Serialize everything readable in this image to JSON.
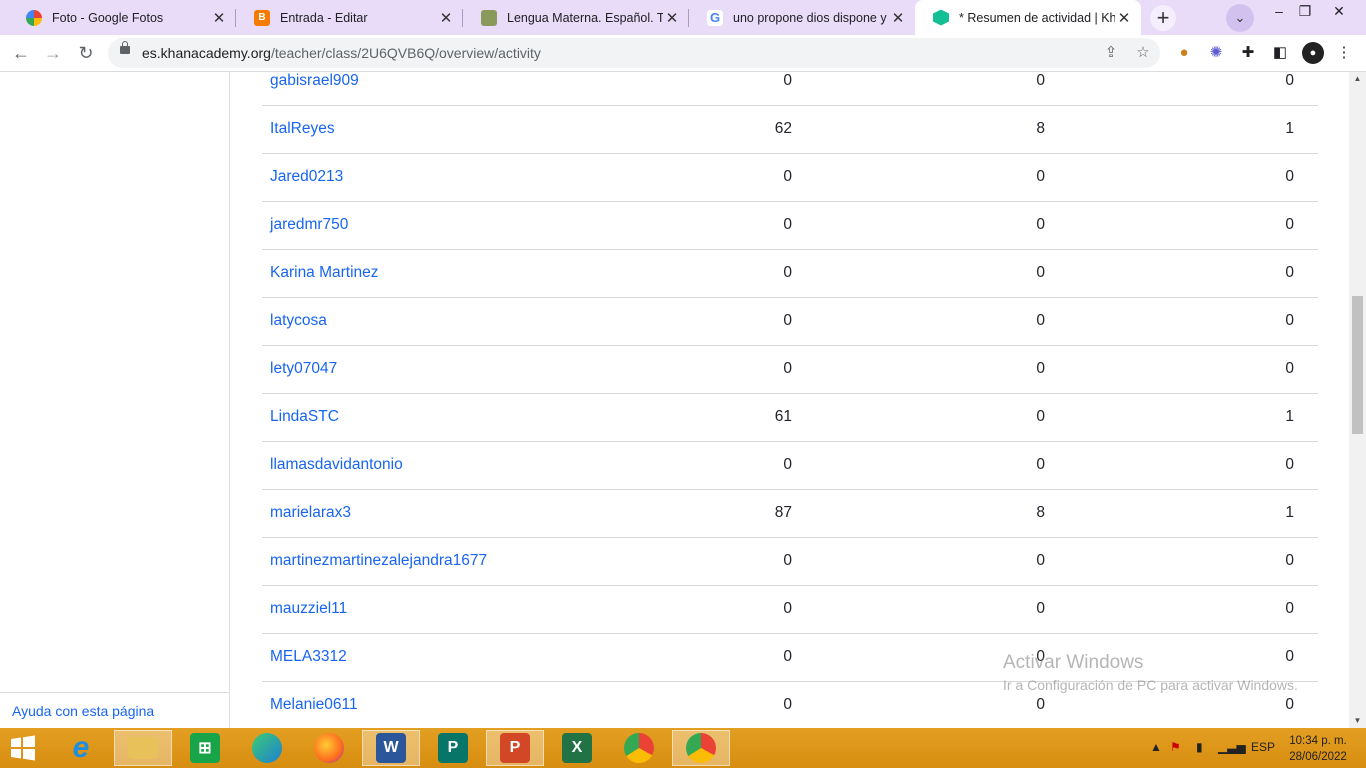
{
  "browser": {
    "tabs": [
      {
        "label": "Foto - Google Fotos",
        "icon": "google-photos-icon",
        "color": "#e94335"
      },
      {
        "label": "Entrada - Editar",
        "icon": "blogger-icon",
        "color": "#f57c00"
      },
      {
        "label": "Lengua Materna. Español. Terc",
        "icon": "sep-book-icon",
        "color": "#8a9a5b"
      },
      {
        "label": "uno propone dios dispone y el",
        "icon": "google-g-icon",
        "color": "#4285f4"
      },
      {
        "label": "* Resumen de actividad | Khan",
        "icon": "khan-academy-icon",
        "color": "#14bf96"
      }
    ],
    "url_host": "es.khanacademy.org",
    "url_path": "/teacher/class/2U6QVB6Q/overview/activity"
  },
  "sidebar": {
    "help_link": "Ayuda con esta página"
  },
  "table": {
    "rows": [
      {
        "name": "gabisrael909",
        "c1": "0",
        "c2": "0",
        "c3": "0"
      },
      {
        "name": "ItalReyes",
        "c1": "62",
        "c2": "8",
        "c3": "1"
      },
      {
        "name": "Jared0213",
        "c1": "0",
        "c2": "0",
        "c3": "0"
      },
      {
        "name": "jaredmr750",
        "c1": "0",
        "c2": "0",
        "c3": "0"
      },
      {
        "name": "Karina Martinez",
        "c1": "0",
        "c2": "0",
        "c3": "0"
      },
      {
        "name": "latycosa",
        "c1": "0",
        "c2": "0",
        "c3": "0"
      },
      {
        "name": "lety07047",
        "c1": "0",
        "c2": "0",
        "c3": "0"
      },
      {
        "name": "LindaSTC",
        "c1": "61",
        "c2": "0",
        "c3": "1"
      },
      {
        "name": "llamasdavidantonio",
        "c1": "0",
        "c2": "0",
        "c3": "0"
      },
      {
        "name": "marielarax3",
        "c1": "87",
        "c2": "8",
        "c3": "1"
      },
      {
        "name": "martinezmartinezalejandra1677",
        "c1": "0",
        "c2": "0",
        "c3": "0"
      },
      {
        "name": "mauzziel11",
        "c1": "0",
        "c2": "0",
        "c3": "0"
      },
      {
        "name": "MELA3312",
        "c1": "0",
        "c2": "0",
        "c3": "0"
      },
      {
        "name": "Melanie0611",
        "c1": "0",
        "c2": "0",
        "c3": "0"
      }
    ]
  },
  "watermark": {
    "title": "Activar Windows",
    "subtitle": "Ir a Configuración de PC para activar Windows."
  },
  "taskbar": {
    "apps": [
      {
        "name": "internet-explorer",
        "glyph": "e",
        "color": "#1e8fe0"
      },
      {
        "name": "file-explorer",
        "glyph": "",
        "color": "#e8c15a"
      },
      {
        "name": "microsoft-store",
        "glyph": "",
        "color": "#1aa44a"
      },
      {
        "name": "edge",
        "glyph": "",
        "color": "#1d7fd4"
      },
      {
        "name": "firefox",
        "glyph": "",
        "color": "#ff6d1f"
      },
      {
        "name": "word",
        "glyph": "W",
        "color": "#2b579a"
      },
      {
        "name": "publisher",
        "glyph": "P",
        "color": "#077568"
      },
      {
        "name": "powerpoint",
        "glyph": "P",
        "color": "#d24726"
      },
      {
        "name": "excel",
        "glyph": "X",
        "color": "#217346"
      },
      {
        "name": "chrome",
        "glyph": "",
        "color": "#ea4335"
      },
      {
        "name": "chrome-active",
        "glyph": "",
        "color": "#ea4335"
      }
    ],
    "language": "ESP",
    "time": "10:34 p. m.",
    "date": "28/06/2022"
  }
}
